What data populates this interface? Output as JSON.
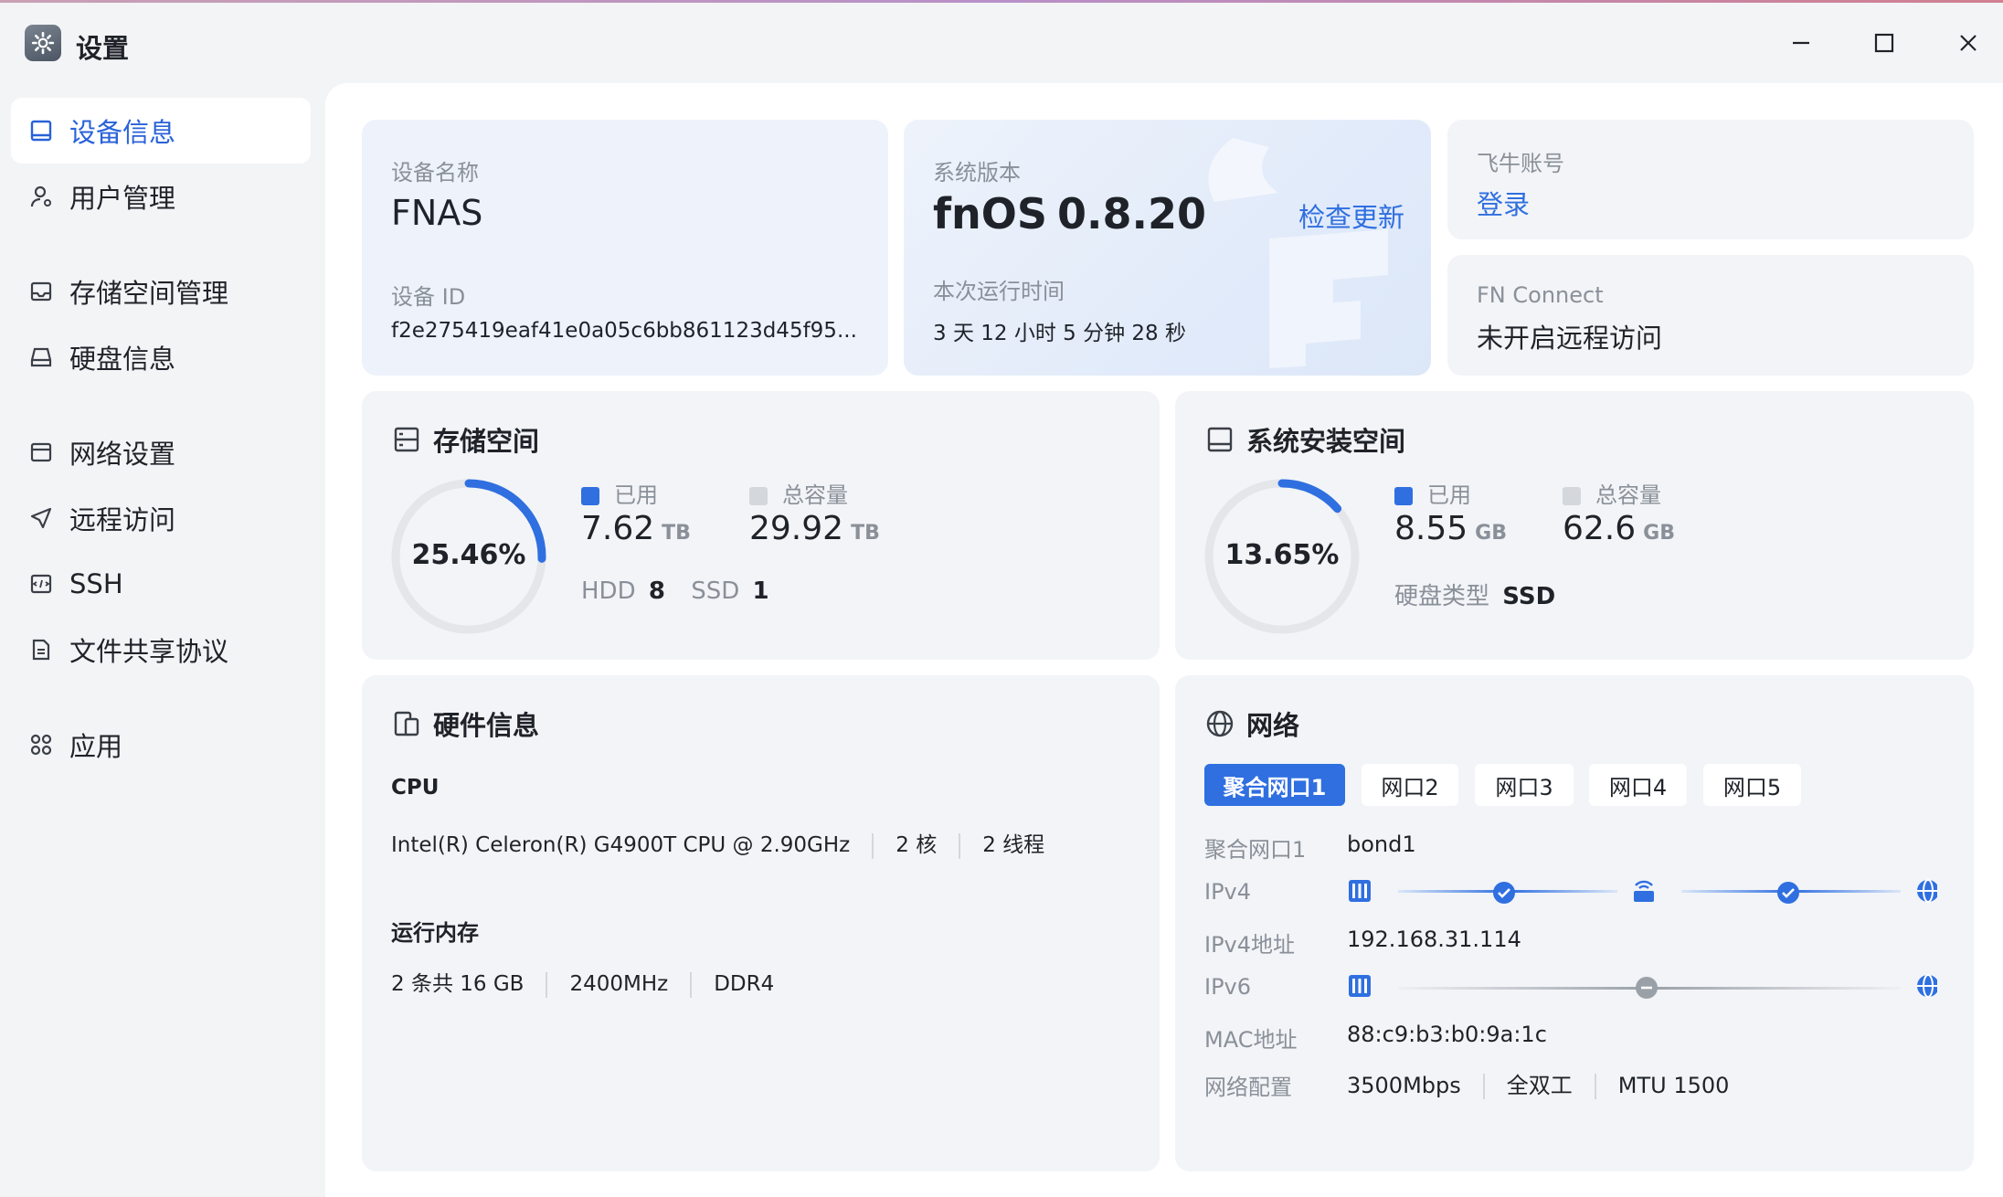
{
  "window": {
    "title": "设置"
  },
  "sidebar": {
    "items": [
      {
        "label": "设备信息",
        "icon": "monitor-icon"
      },
      {
        "label": "用户管理",
        "icon": "user-icon"
      },
      {
        "label": "存储空间管理",
        "icon": "storage-icon"
      },
      {
        "label": "硬盘信息",
        "icon": "disk-icon"
      },
      {
        "label": "网络设置",
        "icon": "network-icon"
      },
      {
        "label": "远程访问",
        "icon": "send-icon"
      },
      {
        "label": "SSH",
        "icon": "terminal-icon"
      },
      {
        "label": "文件共享协议",
        "icon": "document-icon"
      },
      {
        "label": "应用",
        "icon": "apps-icon"
      }
    ]
  },
  "device": {
    "name_label": "设备名称",
    "name": "FNAS",
    "id_label": "设备 ID",
    "id": "f2e275419eaf41e0a05c6bb861123d45f95..."
  },
  "system": {
    "version_label": "系统版本",
    "os": "fnOS",
    "version": "0.8.20",
    "check_update": "检查更新",
    "uptime_label": "本次运行时间",
    "uptime": "3 天 12 小时 5 分钟 28 秒"
  },
  "account": {
    "label": "飞牛账号",
    "login": "登录"
  },
  "connect": {
    "label": "FN Connect",
    "status": "未开启远程访问"
  },
  "storage": {
    "title": "存储空间",
    "percent_text": "25.46%",
    "percent": 0.2546,
    "used_label": "已用",
    "used": "7.62",
    "used_unit": "TB",
    "total_label": "总容量",
    "total": "29.92",
    "total_unit": "TB",
    "hdd_label": "HDD",
    "hdd": "8",
    "ssd_label": "SSD",
    "ssd": "1"
  },
  "sysdisk": {
    "title": "系统安装空间",
    "percent_text": "13.65%",
    "percent": 0.1365,
    "used_label": "已用",
    "used": "8.55",
    "used_unit": "GB",
    "total_label": "总容量",
    "total": "62.6",
    "total_unit": "GB",
    "type_label": "硬盘类型",
    "type": "SSD"
  },
  "hardware": {
    "title": "硬件信息",
    "cpu_label": "CPU",
    "cpu_model": "Intel(R) Celeron(R) G4900T CPU @ 2.90GHz",
    "cpu_cores": "2 核",
    "cpu_threads": "2 线程",
    "mem_label": "运行内存",
    "mem_size": "2 条共 16 GB",
    "mem_speed": "2400MHz",
    "mem_type": "DDR4"
  },
  "network": {
    "title": "网络",
    "tabs": [
      "聚合网口1",
      "网口2",
      "网口3",
      "网口4",
      "网口5"
    ],
    "iface_label": "聚合网口1",
    "iface": "bond1",
    "ipv4_label": "IPv4",
    "ipv4_addr_label": "IPv4地址",
    "ipv4_addr": "192.168.31.114",
    "ipv6_label": "IPv6",
    "mac_label": "MAC地址",
    "mac": "88:c9:b3:b0:9a:1c",
    "config_label": "网络配置",
    "speed": "3500Mbps",
    "duplex": "全双工",
    "mtu": "MTU 1500"
  },
  "colors": {
    "accent": "#2f6fe0",
    "ring_track": "#e4e6ea",
    "muted": "#8a9099",
    "legend_total": "#d4d7dc"
  }
}
